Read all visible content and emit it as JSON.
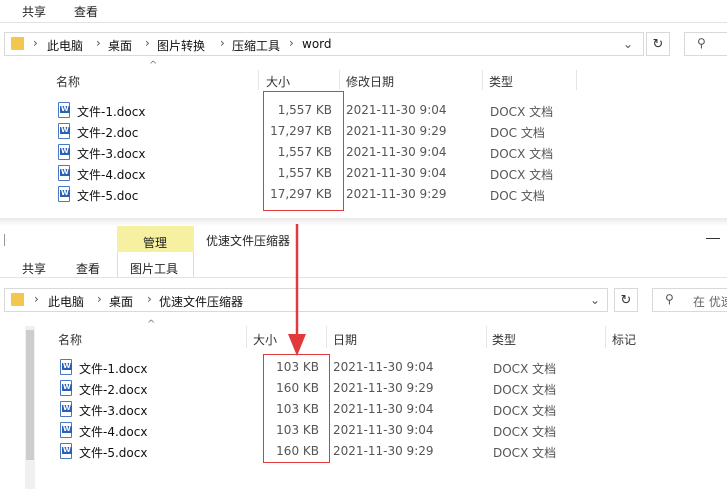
{
  "top_window": {
    "tabs": [
      {
        "label": "共享"
      },
      {
        "label": "查看"
      }
    ],
    "address": [
      "此电脑",
      "桌面",
      "图片转换",
      "压缩工具",
      "word"
    ],
    "columns": {
      "name": "名称",
      "size": "大小",
      "date": "修改日期",
      "type": "类型"
    },
    "files": [
      {
        "name": "文件-1.docx",
        "size": "1,557 KB",
        "date": "2021-11-30 9:04",
        "type": "DOCX 文档"
      },
      {
        "name": "文件-2.doc",
        "size": "17,297 KB",
        "date": "2021-11-30 9:29",
        "type": "DOC 文档"
      },
      {
        "name": "文件-3.docx",
        "size": "1,557 KB",
        "date": "2021-11-30 9:04",
        "type": "DOCX 文档"
      },
      {
        "name": "文件-4.docx",
        "size": "1,557 KB",
        "date": "2021-11-30 9:04",
        "type": "DOCX 文档"
      },
      {
        "name": "文件-5.doc",
        "size": "17,297 KB",
        "date": "2021-11-30 9:29",
        "type": "DOC 文档"
      }
    ]
  },
  "bottom_window": {
    "context_tab": "管理",
    "window_title": "优速文件压缩器",
    "tabs": [
      {
        "label": "共享"
      },
      {
        "label": "查看"
      },
      {
        "label": "图片工具"
      }
    ],
    "address": [
      "此电脑",
      "桌面",
      "优速文件压缩器"
    ],
    "search_placeholder": "在 优速",
    "columns": {
      "name": "名称",
      "size": "大小",
      "date": "日期",
      "type": "类型",
      "tags": "标记"
    },
    "files": [
      {
        "name": "文件-1.docx",
        "size": "103 KB",
        "date": "2021-11-30 9:04",
        "type": "DOCX 文档"
      },
      {
        "name": "文件-2.docx",
        "size": "160 KB",
        "date": "2021-11-30 9:29",
        "type": "DOCX 文档"
      },
      {
        "name": "文件-3.docx",
        "size": "103 KB",
        "date": "2021-11-30 9:04",
        "type": "DOCX 文档"
      },
      {
        "name": "文件-4.docx",
        "size": "103 KB",
        "date": "2021-11-30 9:04",
        "type": "DOCX 文档"
      },
      {
        "name": "文件-5.docx",
        "size": "160 KB",
        "date": "2021-11-30 9:29",
        "type": "DOCX 文档"
      }
    ]
  },
  "colors": {
    "highlight": "#e23a3a",
    "context_tab": "#f5f1a0"
  }
}
